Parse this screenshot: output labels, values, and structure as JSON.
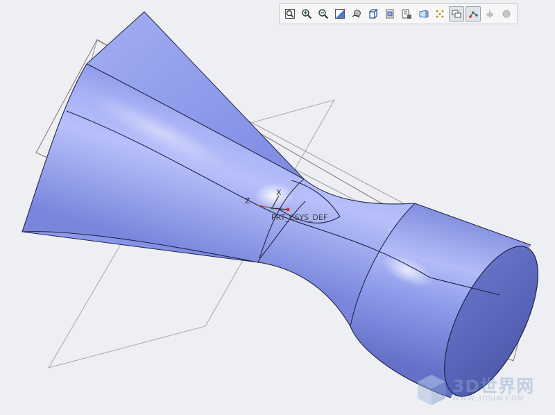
{
  "toolbar": {
    "buttons": [
      {
        "name": "refit-icon"
      },
      {
        "name": "zoom-in-icon"
      },
      {
        "name": "zoom-out-icon"
      },
      {
        "name": "repaint-icon"
      },
      {
        "name": "spin-center-icon"
      },
      {
        "name": "display-style-icon"
      },
      {
        "name": "saved-orientations-icon"
      },
      {
        "name": "view-manager-icon"
      },
      {
        "name": "perspective-view-icon"
      },
      {
        "name": "datum-display-filters-icon"
      },
      {
        "name": "plane-display-icon"
      },
      {
        "name": "axis-display-icon"
      },
      {
        "name": "point-display-icon"
      },
      {
        "name": "csys-display-icon"
      }
    ]
  },
  "model": {
    "csys_label": "PRT_CSYS_DEF",
    "axis_x": "X",
    "axis_z": "Z"
  },
  "watermark": {
    "brand": "3D世界网",
    "url": "WWW.3DSJW.COM"
  },
  "colors": {
    "background": "#eeeff2",
    "surface": "#8e9aed",
    "surface_dark": "#5c6ab8",
    "edge": "#1e2347",
    "datum_plane": "#8a7070"
  }
}
